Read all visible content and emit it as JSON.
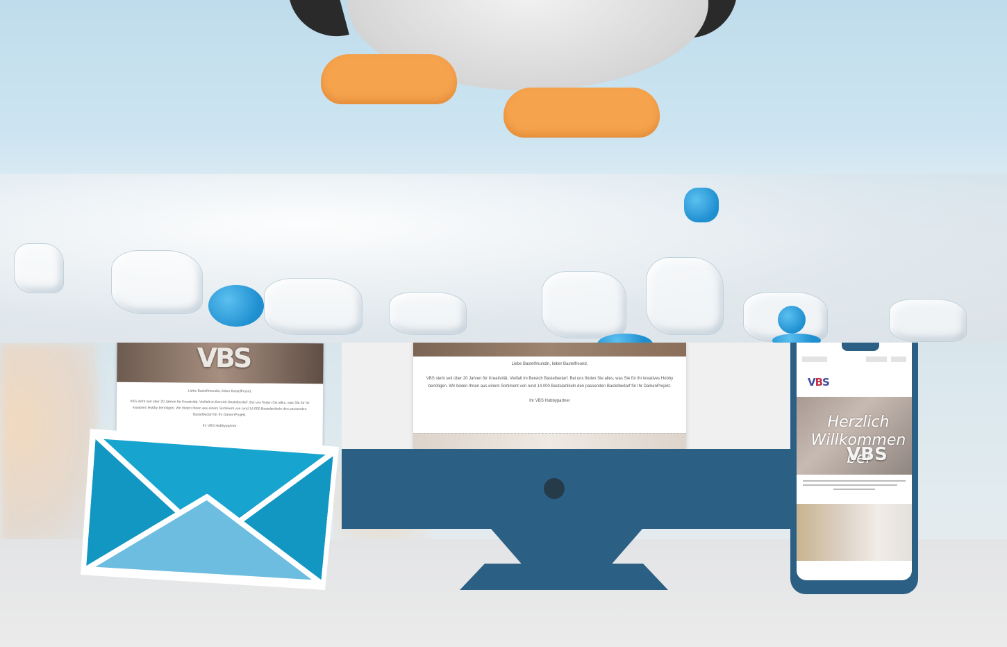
{
  "email": {
    "greeting": "Liebe Bastelfreundin, lieber Bastelfreund,",
    "body": "VBS steht seit über 20 Jahren für Kreativität, Vielfalt im Bereich Bastelbedarf. Bei uns finden Sie alles, was Sie für Ihr kreatives Hobby benötigen. Wir bieten Ihnen aus einem Sortiment von rund 14.000 Bastelartikeln den passenden Bastelbedarf für Ihr DamenProjekt.",
    "signature": "Ihr VBS Hobbypartner"
  },
  "envelope_letter": {
    "brand": "VBS",
    "greeting": "Liebe Bastelfreundin, lieber Bastelfreund,",
    "body": "VBS steht seit über 20 Jahren für Kreativität, Vielfalt im Bereich Bastelbedarf. Bei uns finden Sie alles, was Sie für Ihr kreatives Hobby benötigen. Wir bieten Ihnen aus einem Sortiment von rund 14.000 Bastelartikeln den passenden Bastelbedarf für Ihr DamenProjekt.",
    "signature": "Ihr VBS Hobbypartner"
  },
  "phone": {
    "logo_v": "V",
    "logo_b": "B",
    "logo_s": "S",
    "hero_text": "Herzlich Willkommen bei",
    "hero_brand": "VBS"
  },
  "colors": {
    "device_blue": "#2c5f84",
    "envelope_blue": "#17a4ce",
    "envelope_light": "#6cbde0",
    "penguin_feet": "#f6a34e"
  }
}
